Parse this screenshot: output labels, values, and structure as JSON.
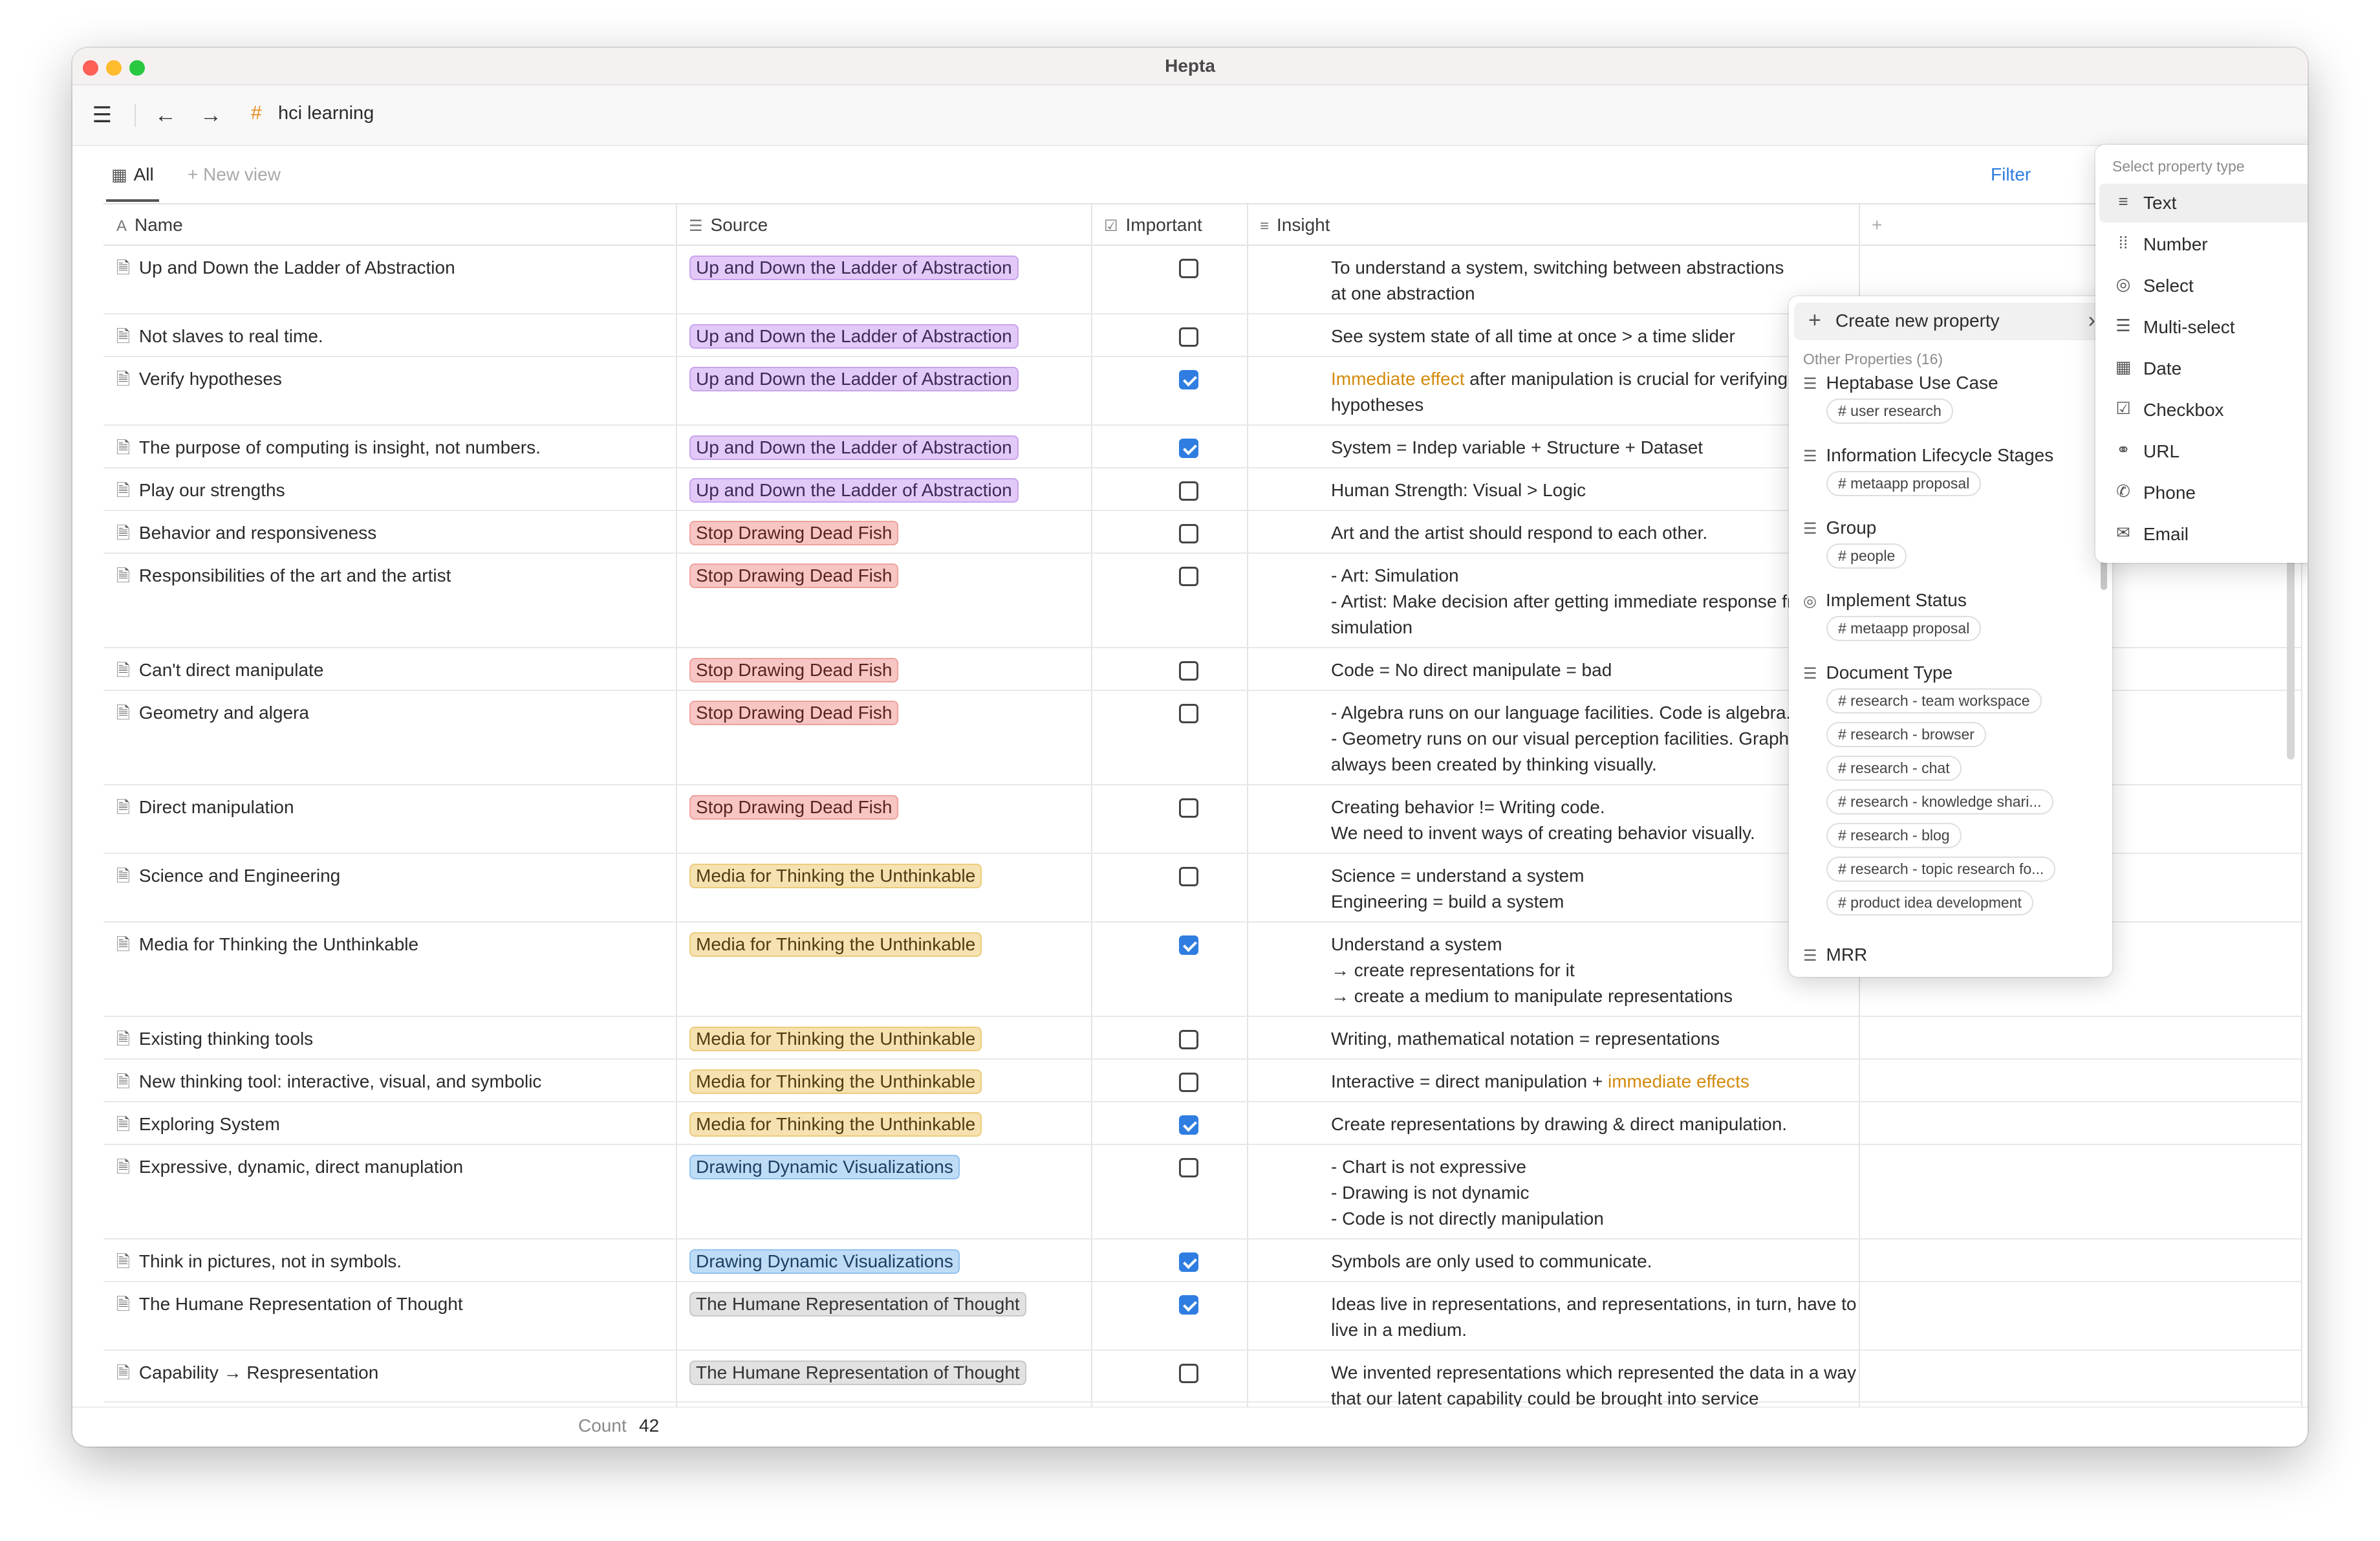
{
  "window": {
    "title": "Hepta"
  },
  "toolbar": {
    "page_title": "hci learning"
  },
  "views": {
    "all_label": "All",
    "new_view_label": "New view",
    "filter_label": "Filter"
  },
  "columns": {
    "name": "Name",
    "source": "Source",
    "important": "Important",
    "insight": "Insight"
  },
  "rows": [
    {
      "name": "Up and Down the Ladder of Abstraction",
      "source": "Up and Down the Ladder of Abstraction",
      "source_color": "purple",
      "important": false,
      "insight": [
        "To understand a system, switching between abstractions",
        "at one abstraction"
      ]
    },
    {
      "name": "Not slaves to real time.",
      "source": "Up and Down the Ladder of Abstraction",
      "source_color": "purple",
      "important": false,
      "insight": [
        "See system state of all time at once > a time slider"
      ]
    },
    {
      "name": "Verify hypotheses",
      "source": "Up and Down the Ladder of Abstraction",
      "source_color": "purple",
      "important": true,
      "insight_highlight": "Immediate effect",
      "insight": [
        "after manipulation is crucial for verifying",
        "hypotheses"
      ]
    },
    {
      "name": "The purpose of computing is insight, not numbers.",
      "source": "Up and Down the Ladder of Abstraction",
      "source_color": "purple",
      "important": true,
      "insight": [
        "System = Indep variable + Structure + Dataset"
      ]
    },
    {
      "name": "Play our strengths",
      "source": "Up and Down the Ladder of Abstraction",
      "source_color": "purple",
      "important": false,
      "insight": [
        "Human Strength: Visual > Logic"
      ]
    },
    {
      "name": "Behavior and responsiveness",
      "source": "Stop Drawing Dead Fish",
      "source_color": "red",
      "important": false,
      "insight": [
        "Art and the artist should respond to each other."
      ]
    },
    {
      "name": "Responsibilities of the art and the artist",
      "source": "Stop Drawing Dead Fish",
      "source_color": "red",
      "important": false,
      "insight": [
        "- Art: Simulation",
        "- Artist: Make decision after getting immediate response from",
        "simulation"
      ]
    },
    {
      "name": "Can't direct manipulate",
      "source": "Stop Drawing Dead Fish",
      "source_color": "red",
      "important": false,
      "insight": [
        "Code = No direct manipulate = bad"
      ]
    },
    {
      "name": "Geometry and algera",
      "source": "Stop Drawing Dead Fish",
      "source_color": "red",
      "important": false,
      "insight": [
        "- Algebra runs on our language facilities. Code is algebra.",
        "- Geometry runs on our visual perception facilities. Graphics",
        "always been created by thinking visually."
      ]
    },
    {
      "name": "Direct manipulation",
      "source": "Stop Drawing Dead Fish",
      "source_color": "red",
      "important": false,
      "insight": [
        "Creating behavior != Writing code.",
        "We need to invent ways of creating behavior visually."
      ]
    },
    {
      "name": "Science and Engineering",
      "source": "Media for Thinking the Unthinkable",
      "source_color": "yellow",
      "important": false,
      "insight": [
        "Science = understand a system",
        "Engineering = build a system"
      ]
    },
    {
      "name": "Media for Thinking the Unthinkable",
      "source": "Media for Thinking the Unthinkable",
      "source_color": "yellow",
      "important": true,
      "insight": [
        "Understand a system",
        "→ create representations for it",
        "→ create a medium to manipulate representations"
      ]
    },
    {
      "name": "Existing thinking tools",
      "source": "Media for Thinking the Unthinkable",
      "source_color": "yellow",
      "important": false,
      "insight": [
        "Writing, mathematical notation = representations"
      ]
    },
    {
      "name": "New thinking tool: interactive, visual, and symbolic",
      "source": "Media for Thinking the Unthinkable",
      "source_color": "yellow",
      "important": false,
      "insight_prefix": "Interactive = direct manipulation + ",
      "insight_highlight": "immediate effects",
      "insight": []
    },
    {
      "name": "Exploring System",
      "source": "Media for Thinking the Unthinkable",
      "source_color": "yellow",
      "important": true,
      "insight": [
        "Create representations by drawing & direct manipulation."
      ]
    },
    {
      "name": "Expressive, dynamic, direct manuplation",
      "source": "Drawing Dynamic Visualizations",
      "source_color": "blue",
      "important": false,
      "insight": [
        "- Chart is not expressive",
        "- Drawing is not dynamic",
        "- Code is not directly manipulation"
      ]
    },
    {
      "name": "Think in pictures, not in symbols.",
      "source": "Drawing Dynamic Visualizations",
      "source_color": "blue",
      "important": true,
      "insight": [
        "Symbols are only used to communicate."
      ]
    },
    {
      "name": "The Humane Representation of Thought",
      "source": "The Humane Representation of Thought",
      "source_color": "gray",
      "important": true,
      "insight": [
        "Ideas live in representations, and representations, in turn, have to",
        "live in a medium."
      ]
    },
    {
      "name": "Capability → Respresentation",
      "source": "The Humane Representation of Thought",
      "source_color": "gray",
      "important": false,
      "insight": [
        "We invented representations which represented the data in a way",
        "that our latent capability could be brought into service"
      ]
    }
  ],
  "footer": {
    "count_label": "Count",
    "count_value": "42"
  },
  "property_menu": {
    "create_label": "Create new property",
    "other_header": "Other Properties (16)",
    "properties": [
      {
        "name": "Heptabase Use Case",
        "icon": "list-icon",
        "tags": [
          "# user research"
        ]
      },
      {
        "name": "Information Lifecycle Stages",
        "icon": "list-icon",
        "tags": [
          "# metaapp proposal"
        ]
      },
      {
        "name": "Group",
        "icon": "list-icon",
        "tags": [
          "# people"
        ]
      },
      {
        "name": "Implement Status",
        "icon": "select-icon",
        "tags": [
          "# metaapp proposal"
        ]
      },
      {
        "name": "Document Type",
        "icon": "list-icon",
        "tags": [
          "# research - team workspace",
          "# research - browser",
          "# research - chat",
          "# research - knowledge shari...",
          "# research - blog",
          "# research - topic research fo...",
          "# product idea development"
        ]
      },
      {
        "name": "MRR",
        "icon": "list-icon",
        "tags": []
      }
    ]
  },
  "type_menu": {
    "header": "Select property type",
    "types": [
      {
        "label": "Text",
        "icon": "text-icon"
      },
      {
        "label": "Number",
        "icon": "number-icon"
      },
      {
        "label": "Select",
        "icon": "select-icon"
      },
      {
        "label": "Multi-select",
        "icon": "multi-select-icon"
      },
      {
        "label": "Date",
        "icon": "calendar-icon"
      },
      {
        "label": "Checkbox",
        "icon": "checkbox-icon"
      },
      {
        "label": "URL",
        "icon": "link-icon"
      },
      {
        "label": "Phone",
        "icon": "phone-icon"
      },
      {
        "label": "Email",
        "icon": "email-icon"
      }
    ]
  }
}
